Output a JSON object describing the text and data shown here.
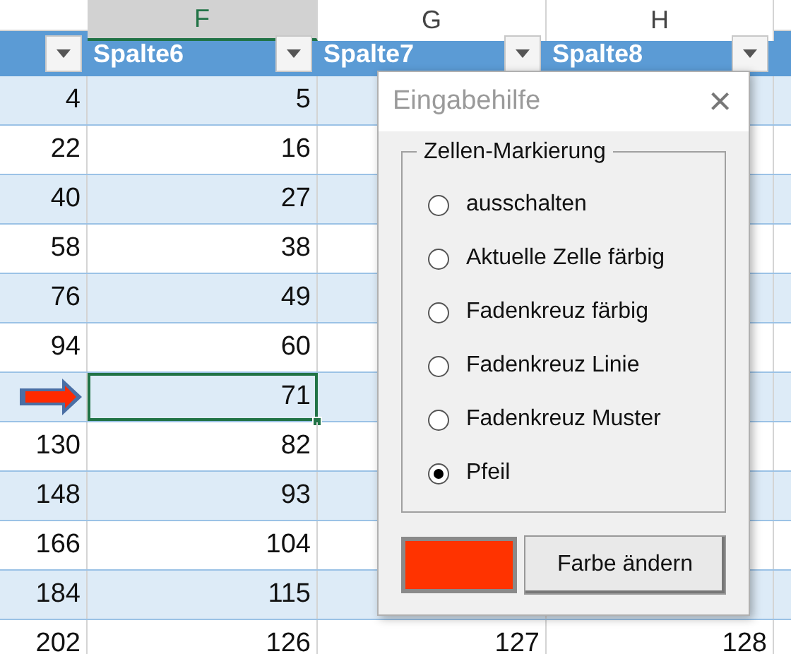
{
  "column_letters": [
    {
      "label": "F",
      "selected": true
    },
    {
      "label": "G",
      "selected": false
    },
    {
      "label": "H",
      "selected": false
    }
  ],
  "table": {
    "columns": [
      {
        "label": "Spalte6"
      },
      {
        "label": "Spalte7"
      },
      {
        "label": "Spalte8"
      }
    ],
    "rows": [
      {
        "cells": {
          "e": "4",
          "f": "5"
        }
      },
      {
        "cells": {
          "e": "22",
          "f": "16"
        }
      },
      {
        "cells": {
          "e": "40",
          "f": "27"
        }
      },
      {
        "cells": {
          "e": "58",
          "f": "38"
        }
      },
      {
        "cells": {
          "e": "76",
          "f": "49"
        }
      },
      {
        "cells": {
          "e": "94",
          "f": "60"
        }
      },
      {
        "cells": {
          "f": "71"
        },
        "selected": true,
        "arrow": true
      },
      {
        "cells": {
          "e": "130",
          "f": "82"
        }
      },
      {
        "cells": {
          "e": "148",
          "f": "93"
        }
      },
      {
        "cells": {
          "e": "166",
          "f": "104"
        }
      },
      {
        "cells": {
          "e": "184",
          "f": "115"
        }
      },
      {
        "cells": {
          "e": "202",
          "f": "126",
          "g": "127",
          "h": "128"
        }
      }
    ]
  },
  "dialog": {
    "title": "Eingabehilfe",
    "close": "×",
    "group": "Zellen-Markierung",
    "options": [
      {
        "label": "ausschalten",
        "selected": false
      },
      {
        "label": "Aktuelle Zelle färbig",
        "selected": false
      },
      {
        "label": "Fadenkreuz färbig",
        "selected": false
      },
      {
        "label": "Fadenkreuz Linie",
        "selected": false
      },
      {
        "label": "Fadenkreuz Muster",
        "selected": false
      },
      {
        "label": "Pfeil",
        "selected": true
      }
    ],
    "swatch": {
      "color": "#ff3300"
    },
    "button": "Farbe ändern"
  }
}
